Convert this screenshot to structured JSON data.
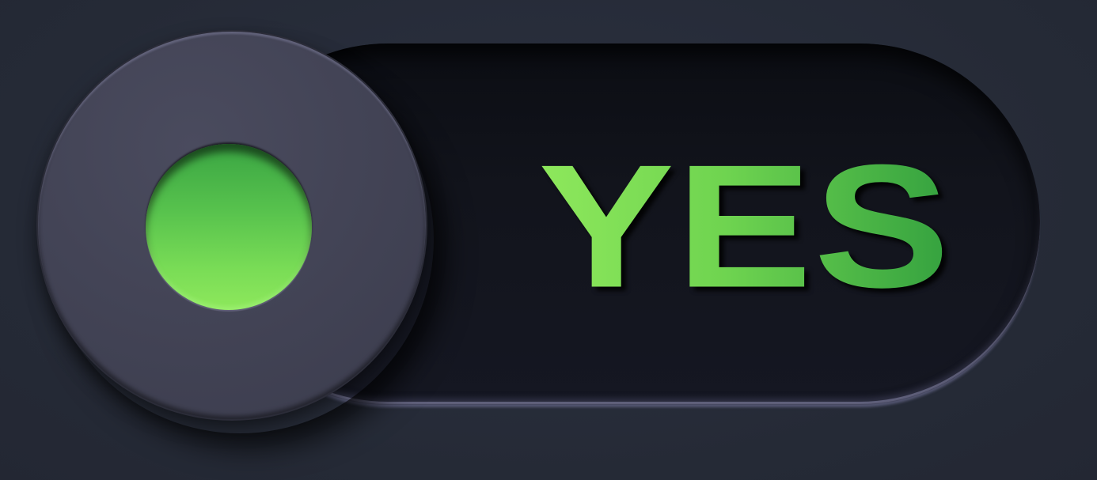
{
  "toggle": {
    "label": "YES",
    "state": "on"
  },
  "colors": {
    "background": "#262b38",
    "track": "#12141c",
    "knob": "#434456",
    "accent_light": "#8ee85c",
    "accent_dark": "#34a13f"
  }
}
